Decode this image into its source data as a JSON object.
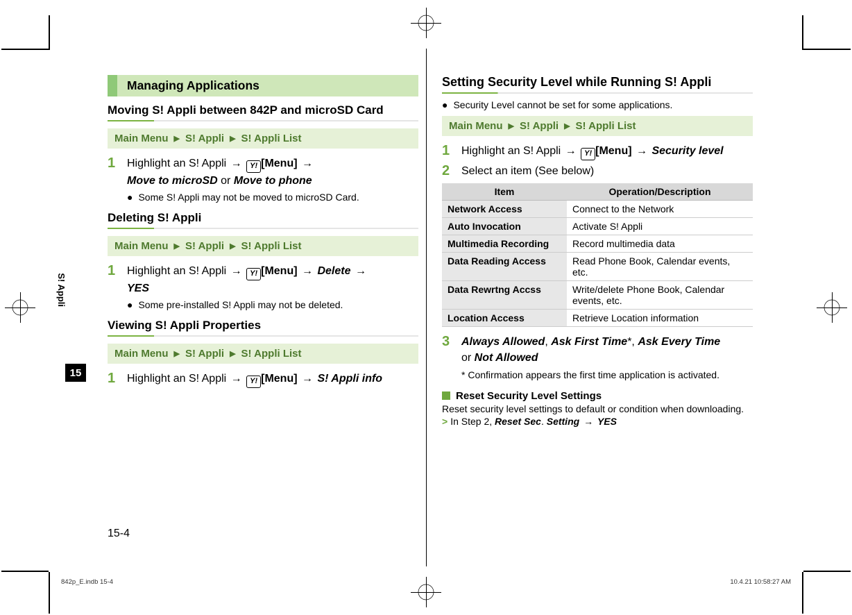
{
  "tab": {
    "label": "S! Appli",
    "number": "15"
  },
  "page_number": "15-4",
  "footer": {
    "left": "842p_E.indb   15-4",
    "right": "10.4.21   10:58:27 AM"
  },
  "left": {
    "banner": "Managing Applications",
    "moving": {
      "title": "Moving S! Appli between 842P and microSD Card",
      "nav": {
        "a": "Main Menu",
        "b": "S! Appli",
        "c": "S! Appli List"
      },
      "step1": {
        "num": "1",
        "lead": "Highlight an S! Appli",
        "menu": "[Menu]",
        "key": "Y!",
        "opt1": "Move to microSD",
        "or": " or ",
        "opt2": "Move to phone"
      },
      "bullet": "Some S! Appli may not be moved to microSD Card."
    },
    "deleting": {
      "title": "Deleting S! Appli",
      "nav": {
        "a": "Main Menu",
        "b": "S! Appli",
        "c": "S! Appli List"
      },
      "step1": {
        "num": "1",
        "lead": "Highlight an S! Appli",
        "menu": "[Menu]",
        "key": "Y!",
        "opt1": "Delete",
        "opt2": "YES"
      },
      "bullet": "Some pre-installed S! Appli may not be deleted."
    },
    "viewing": {
      "title": "Viewing S! Appli Properties",
      "nav": {
        "a": "Main Menu",
        "b": "S! Appli",
        "c": "S! Appli List"
      },
      "step1": {
        "num": "1",
        "lead": "Highlight an S! Appli",
        "menu": "[Menu]",
        "key": "Y!",
        "opt1": "S! Appli info"
      }
    }
  },
  "right": {
    "title": "Setting Security Level while Running S! Appli",
    "bullet": "Security Level cannot be set for some applications.",
    "nav": {
      "a": "Main Menu",
      "b": "S! Appli",
      "c": "S! Appli List"
    },
    "step1": {
      "num": "1",
      "lead": "Highlight an S! Appli",
      "menu": "[Menu]",
      "key": "Y!",
      "opt1": "Security level"
    },
    "step2": {
      "num": "2",
      "text": "Select an item (See below)"
    },
    "table": {
      "h1": "Item",
      "h2": "Operation/Description",
      "rows": [
        {
          "k": "Network Access",
          "v": "Connect to the Network"
        },
        {
          "k": "Auto Invocation",
          "v": "Activate S! Appli"
        },
        {
          "k": "Multimedia Recording",
          "v": "Record multimedia data"
        },
        {
          "k": "Data Reading Access",
          "v": "Read Phone Book, Calendar events, etc."
        },
        {
          "k": "Data Rewrtng Accss",
          "v": "Write/delete Phone Book, Calendar events, etc."
        },
        {
          "k": "Location Access",
          "v": "Retrieve Location information"
        }
      ]
    },
    "step3": {
      "num": "3",
      "o1": "Always Allowed",
      "c1": ", ",
      "o2": "Ask First Time",
      "star": "*",
      "c2": ", ",
      "o3": "Ask Every Time",
      "or": "or ",
      "o4": "Not Allowed",
      "foot_star": "*",
      "foot_text": " Confirmation appears the first time application is activated."
    },
    "reset": {
      "title": "Reset Security Level Settings",
      "desc": "Reset security level settings to default or condition when downloading.",
      "lead": "In Step 2, ",
      "b1": "Reset Sec",
      "dot": ". ",
      "b2": "Setting",
      "arrow": " → ",
      "b3": "YES"
    }
  }
}
